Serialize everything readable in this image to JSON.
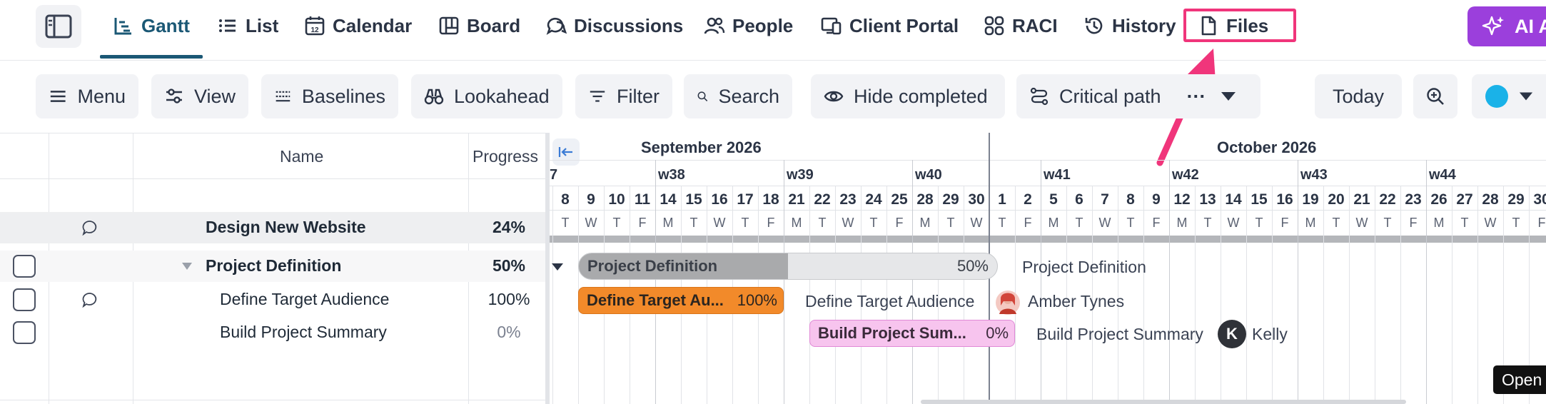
{
  "nav": {
    "tabs": [
      {
        "label": "Gantt",
        "icon": "gantt-icon",
        "active": true
      },
      {
        "label": "List",
        "icon": "list-icon"
      },
      {
        "label": "Calendar",
        "icon": "calendar-icon"
      },
      {
        "label": "Board",
        "icon": "board-icon"
      },
      {
        "label": "Discussions",
        "icon": "discussions-icon"
      },
      {
        "label": "People",
        "icon": "people-icon"
      },
      {
        "label": "Client Portal",
        "icon": "client-portal-icon"
      },
      {
        "label": "RACI",
        "icon": "raci-icon"
      },
      {
        "label": "History",
        "icon": "history-icon"
      },
      {
        "label": "Files",
        "icon": "file-icon"
      }
    ],
    "ai_button": "AI A",
    "accent": "#1b5875",
    "highlight_color": "#f0357b"
  },
  "toolbar": {
    "menu": "Menu",
    "view": "View",
    "baselines": "Baselines",
    "lookahead": "Lookahead",
    "filter": "Filter",
    "search": "Search",
    "hide_completed": "Hide completed",
    "critical_path": "Critical path",
    "more": "···",
    "today": "Today",
    "color_dot": "#1ab2e8"
  },
  "grid": {
    "col_name": "Name",
    "col_progress": "Progress",
    "rows": [
      {
        "name": "Design New Website",
        "progress": "24%"
      },
      {
        "name": "Project Definition",
        "progress": "50%"
      },
      {
        "name": "Define Target Audience",
        "progress": "100%"
      },
      {
        "name": "Build Project Summary",
        "progress": "0%"
      }
    ]
  },
  "timeline": {
    "months": [
      "September 2026",
      "October 2026"
    ],
    "weeks": [
      "7",
      "w38",
      "w39",
      "w40",
      "w41",
      "w42",
      "w43",
      "w44"
    ],
    "days": [
      {
        "d": "8",
        "w": "T"
      },
      {
        "d": "9",
        "w": "W"
      },
      {
        "d": "10",
        "w": "T"
      },
      {
        "d": "11",
        "w": "F"
      },
      {
        "d": "14",
        "w": "M"
      },
      {
        "d": "15",
        "w": "T"
      },
      {
        "d": "16",
        "w": "W"
      },
      {
        "d": "17",
        "w": "T"
      },
      {
        "d": "18",
        "w": "F"
      },
      {
        "d": "21",
        "w": "M"
      },
      {
        "d": "22",
        "w": "T"
      },
      {
        "d": "23",
        "w": "W"
      },
      {
        "d": "24",
        "w": "T"
      },
      {
        "d": "25",
        "w": "F"
      },
      {
        "d": "28",
        "w": "M"
      },
      {
        "d": "29",
        "w": "T"
      },
      {
        "d": "30",
        "w": "W"
      },
      {
        "d": "1",
        "w": "T"
      },
      {
        "d": "2",
        "w": "F"
      },
      {
        "d": "5",
        "w": "M"
      },
      {
        "d": "6",
        "w": "T"
      },
      {
        "d": "7",
        "w": "W"
      },
      {
        "d": "8",
        "w": "T"
      },
      {
        "d": "9",
        "w": "F"
      },
      {
        "d": "12",
        "w": "M"
      },
      {
        "d": "13",
        "w": "T"
      },
      {
        "d": "14",
        "w": "W"
      },
      {
        "d": "15",
        "w": "T"
      },
      {
        "d": "16",
        "w": "F"
      },
      {
        "d": "19",
        "w": "M"
      },
      {
        "d": "20",
        "w": "T"
      },
      {
        "d": "21",
        "w": "W"
      },
      {
        "d": "22",
        "w": "T"
      },
      {
        "d": "23",
        "w": "F"
      },
      {
        "d": "26",
        "w": "M"
      },
      {
        "d": "27",
        "w": "T"
      },
      {
        "d": "28",
        "w": "W"
      },
      {
        "d": "29",
        "w": "T"
      },
      {
        "d": "30",
        "w": "F"
      }
    ],
    "bars": [
      {
        "label": "Project Definition",
        "pct": "50%",
        "side_label": "Project Definition",
        "progress": 0.5
      },
      {
        "label": "Define Target Au...",
        "pct": "100%",
        "side_label": "Define Target Audience",
        "assignee": "Amber Tynes",
        "progress": 1.0
      },
      {
        "label": "Build Project Sum...",
        "pct": "0%",
        "side_label": "Build Project Summary",
        "assignee": "Kelly",
        "avatar_initial": "K",
        "progress": 0.0
      }
    ],
    "colors": {
      "summary": "#a9aaac",
      "summary_track": "#e6e7e9",
      "orange": "#f28a2a",
      "pink": "#f7c4ee",
      "pink_border": "#e08ad6"
    }
  },
  "tooltip": "Open"
}
